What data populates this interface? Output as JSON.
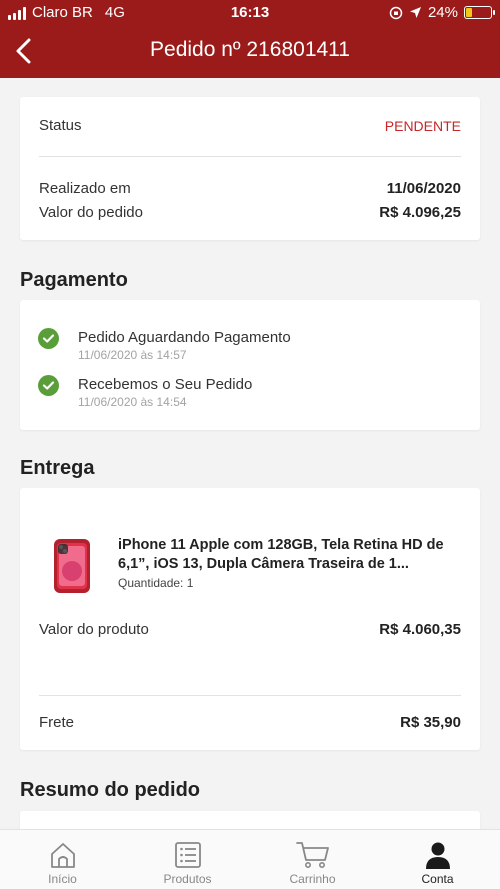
{
  "status_bar": {
    "carrier": "Claro BR",
    "network": "4G",
    "time": "16:13",
    "battery": "24%",
    "battery_level": 0.24
  },
  "header": {
    "title": "Pedido nº 216801411"
  },
  "summary": {
    "status_label": "Status",
    "status_value": "PENDENTE",
    "status_color": "#c62828",
    "date_label": "Realizado em",
    "date_value": "11/06/2020",
    "total_label": "Valor do pedido",
    "total_value": "R$ 4.096,25"
  },
  "payment": {
    "section_title": "Pagamento",
    "steps": [
      {
        "title": "Pedido Aguardando Pagamento",
        "time": "11/06/2020 às 14:57"
      },
      {
        "title": "Recebemos o Seu Pedido",
        "time": "11/06/2020 às 14:54"
      }
    ]
  },
  "delivery": {
    "section_title": "Entrega",
    "product_name": "iPhone 11 Apple com 128GB, Tela Retina HD de 6,1”, iOS 13, Dupla Câmera Traseira de 1...",
    "quantity": "Quantidade: 1",
    "product_value_label": "Valor do produto",
    "product_value": "R$ 4.060,35",
    "shipping_label": "Frete",
    "shipping_value": "R$ 35,90"
  },
  "resumo": {
    "section_title": "Resumo do pedido"
  },
  "tabbar": {
    "items": [
      {
        "label": "Início",
        "icon": "home-icon"
      },
      {
        "label": "Produtos",
        "icon": "list-icon"
      },
      {
        "label": "Carrinho",
        "icon": "cart-icon"
      },
      {
        "label": "Conta",
        "icon": "user-icon"
      }
    ],
    "active": "Conta"
  },
  "colors": {
    "brand": "#9b1b1b",
    "success": "#5a9e3a",
    "pending": "#c62828"
  }
}
